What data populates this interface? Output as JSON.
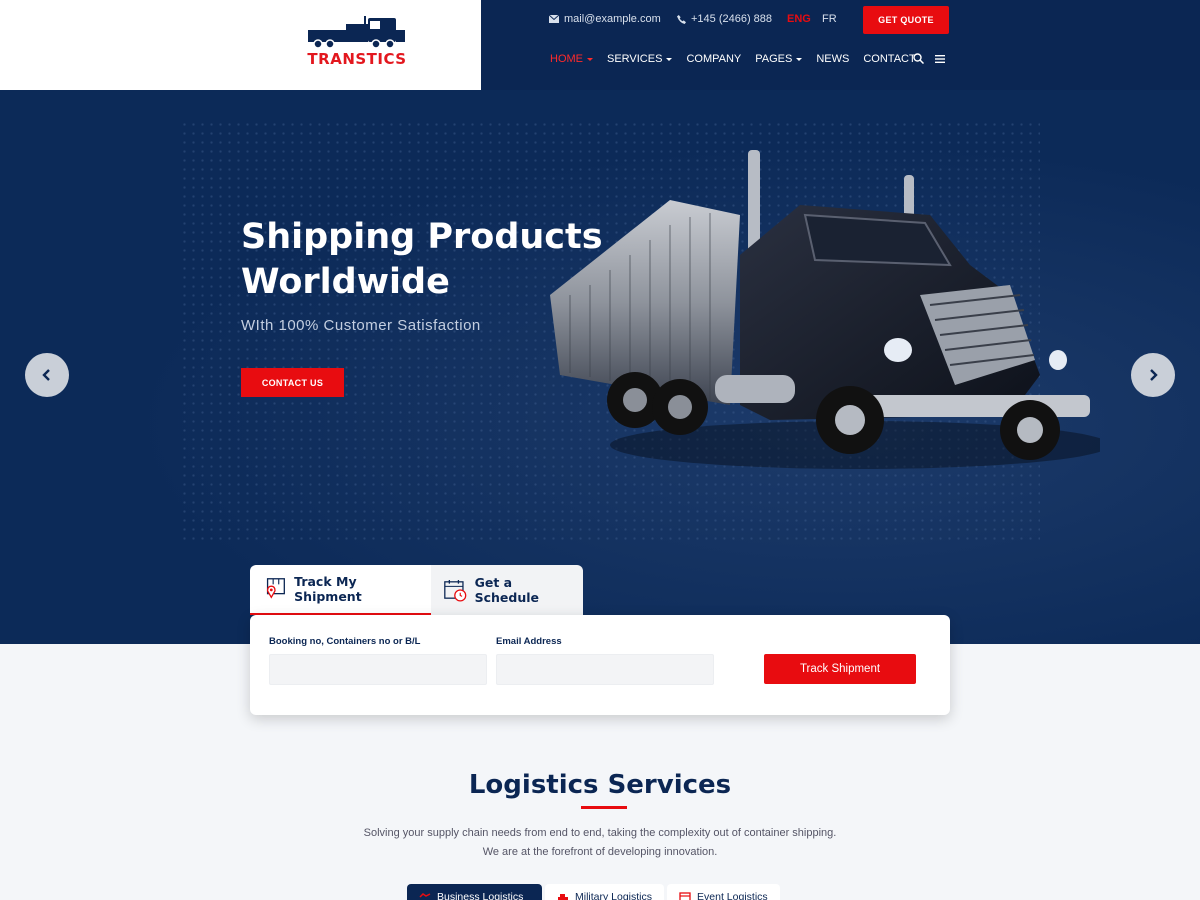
{
  "brand": {
    "name": "TRANSTICS"
  },
  "topbar": {
    "email": "mail@example.com",
    "phone": "+145 (2466) 888",
    "lang_active": "ENG",
    "lang_other": "FR",
    "cta": "GET QUOTE"
  },
  "nav": {
    "items": [
      {
        "label": "HOME",
        "dropdown": true,
        "active": true
      },
      {
        "label": "SERVICES",
        "dropdown": true,
        "active": false
      },
      {
        "label": "COMPANY",
        "dropdown": false,
        "active": false
      },
      {
        "label": "PAGES",
        "dropdown": true,
        "active": false
      },
      {
        "label": "NEWS",
        "dropdown": false,
        "active": false
      },
      {
        "label": "CONTACT",
        "dropdown": false,
        "active": false
      }
    ]
  },
  "hero": {
    "title_line1": "Shipping Products",
    "title_line2": "Worldwide",
    "subtitle": "WIth 100% Customer Satisfaction",
    "button": "CONTACT US"
  },
  "tracking": {
    "tabs": [
      "Track My Shipment",
      "Get a Schedule"
    ],
    "field1_label": "Booking no, Containers no or B/L",
    "field2_label": "Email Address",
    "button": "Track Shipment"
  },
  "services": {
    "title": "Logistics Services",
    "desc_line1": "Solving your supply chain needs from end to end, taking the complexity out of container shipping.",
    "desc_line2": "We are at the forefront of developing innovation.",
    "tabs": [
      "Business Logistics",
      "Military Logistics",
      "Event Logistics"
    ]
  },
  "colors": {
    "navy": "#0b2653",
    "red": "#e80c10",
    "white": "#ffffff"
  }
}
